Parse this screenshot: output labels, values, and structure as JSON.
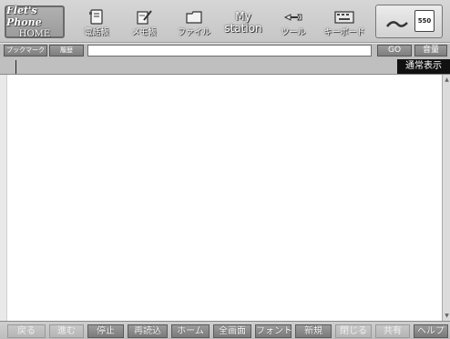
{
  "launcher": {
    "home_line1": "Flet's Phone",
    "home_line2": "HOME",
    "phonebook_label": "電話帳",
    "memo_label": "メモ帳",
    "file_label": "ファイル",
    "mystation_line1": "My",
    "mystation_line2": "station",
    "tool_label": "ツール",
    "keyboard_label": "キーボード",
    "calendar_text": "550"
  },
  "address_bar": {
    "bookmark_label": "ブックマーク",
    "history_label": "履歴",
    "url_value": "",
    "go_label": "GO",
    "sound_label": "音量"
  },
  "display_mode": "通常表示",
  "bottom_nav": {
    "back": "戻る",
    "forward": "進む",
    "stop": "停止",
    "reload": "再読込",
    "home": "ホーム",
    "fullscreen": "全画面",
    "font": "フォント",
    "new_window": "新規",
    "close": "閉じる",
    "share": "共有",
    "help": "ヘルプ"
  },
  "icons": {
    "phonebook": "phonebook-icon",
    "memo": "memo-pencil-icon",
    "file": "folder-icon",
    "tool": "tool-icon",
    "keyboard": "keyboard-icon",
    "calendar": "calendar-icon"
  },
  "colors": {
    "toolbar_bg": "#c9c9c9",
    "button_bg": "#8a8a8a",
    "display_mode_bg": "#111111",
    "content_bg": "#ffffff"
  }
}
